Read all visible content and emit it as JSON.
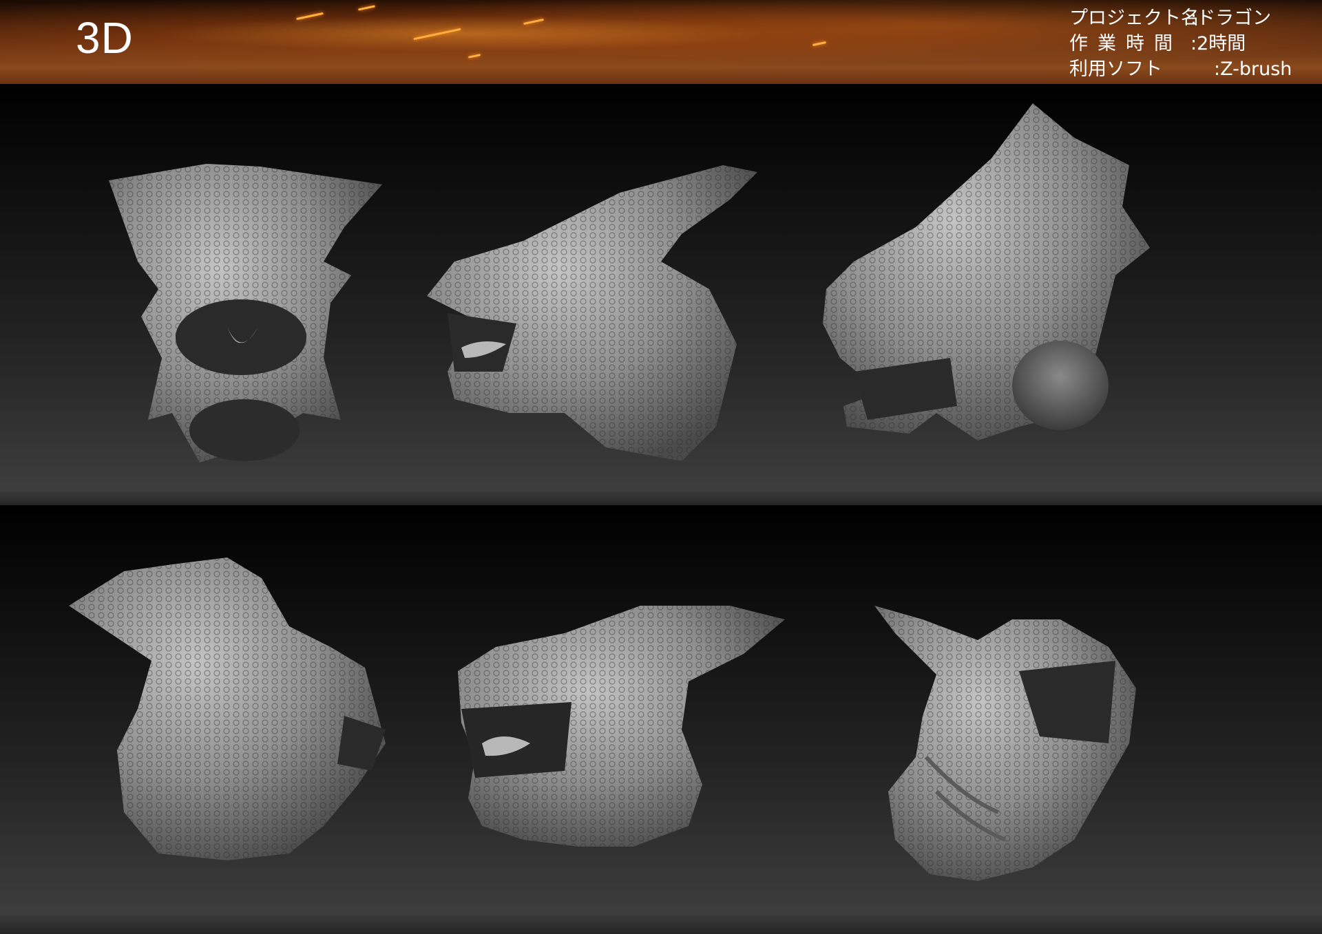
{
  "header": {
    "title": "3D",
    "info": [
      {
        "key": "プロジェクト名",
        "value": ":ドラゴン"
      },
      {
        "key": "作業時間",
        "value": ":2時間"
      },
      {
        "key": "利用ソフト",
        "value": ":Z-brush"
      }
    ]
  },
  "renders": [
    {
      "view": "front"
    },
    {
      "view": "left three-quarter"
    },
    {
      "view": "right side top"
    },
    {
      "view": "rear three-quarter"
    },
    {
      "view": "left side low"
    },
    {
      "view": "underside"
    }
  ],
  "colors": {
    "header_fire": "#8a4a1c",
    "sculpt_grey": "#9a9a9a",
    "background_dark": "#000000"
  }
}
